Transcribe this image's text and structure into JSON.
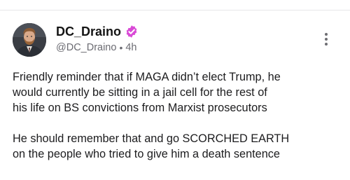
{
  "author": {
    "display_name": "DC_Draino",
    "handle": "@DC_Draino",
    "separator": "•",
    "time_ago": "4h",
    "verified_color": "#d94ad6"
  },
  "post": {
    "paragraphs": [
      {
        "lines": [
          "Friendly reminder that if MAGA didn’t elect Trump, he",
          "would currently be sitting in a jail cell for the rest of",
          "his life on BS convictions from Marxist prosecutors"
        ]
      },
      {
        "lines": [
          "He should remember that and go SCORCHED EARTH",
          "on the people who tried to give him a death sentence"
        ]
      }
    ]
  },
  "icons": {
    "verified": "verified-badge-icon",
    "more": "more-vertical-icon"
  }
}
